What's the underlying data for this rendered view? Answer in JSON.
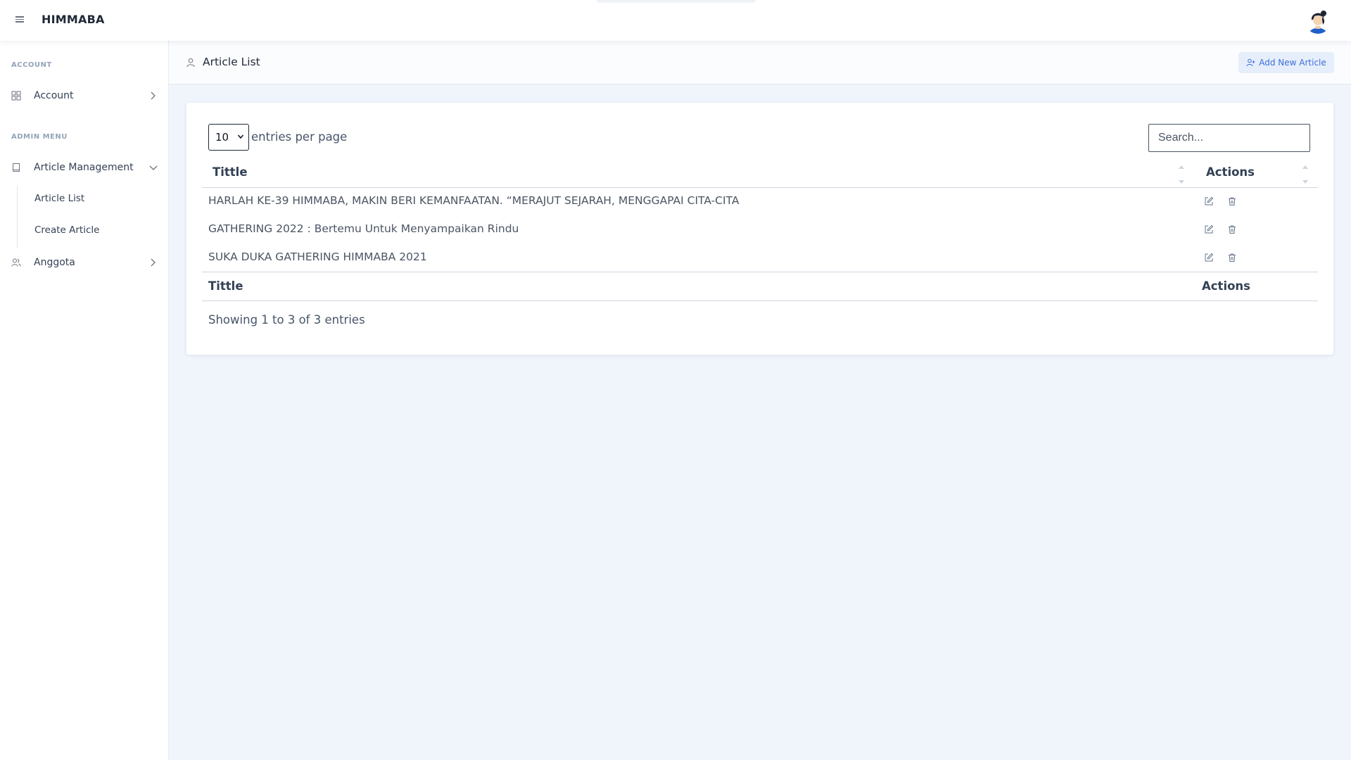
{
  "app": {
    "brand": "HIMMABA"
  },
  "sidebar": {
    "sections": [
      {
        "label": "ACCOUNT"
      },
      {
        "label": "ADMIN MENU"
      }
    ],
    "items": [
      {
        "label": "Account",
        "icon": "grid-icon"
      },
      {
        "label": "Article Management",
        "icon": "book-icon"
      },
      {
        "label": "Anggota",
        "icon": "users-icon"
      }
    ],
    "submenu": [
      {
        "label": "Article List"
      },
      {
        "label": "Create Article"
      }
    ]
  },
  "page": {
    "title": "Article List",
    "add_button_label": "Add New Article"
  },
  "table": {
    "per_page_value": "10",
    "per_page_label": "entries per page",
    "search_placeholder": "Search...",
    "header": {
      "title": "Tittle",
      "actions": "Actions"
    },
    "rows": [
      {
        "title": "HARLAH KE-39 HIMMABA, MAKIN BERI KEMANFAATAN. “MERAJUT SEJARAH, MENGGAPAI CITA-CITA"
      },
      {
        "title": "GATHERING 2022 : Bertemu Untuk Menyampaikan Rindu"
      },
      {
        "title": "SUKA DUKA GATHERING HIMMABA 2021"
      }
    ],
    "footer": {
      "title": "Tittle",
      "actions": "Actions"
    },
    "info": "Showing 1 to 3 of 3 entries"
  },
  "colors": {
    "accent": "#3b6fd8",
    "background": "#f0f4fb"
  }
}
